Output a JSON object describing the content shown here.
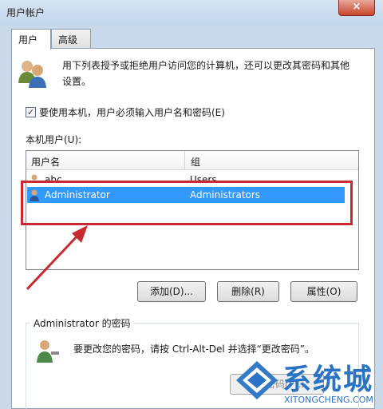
{
  "window": {
    "title": "用户帐户",
    "close_label": "×"
  },
  "tabs": [
    {
      "label": "用户",
      "active": true
    },
    {
      "label": "高级",
      "active": false
    }
  ],
  "description": {
    "line1": "用下列表授予或拒绝用户访问您的计算机，还可以更改其密码和其他",
    "line2": "设置。"
  },
  "require_login": {
    "checked": true,
    "mark": "✓",
    "label": "要使用本机，用户必须输入用户名和密码(E)"
  },
  "users_section": {
    "label": "本机用户(U):",
    "columns": [
      "用户名",
      "组"
    ],
    "rows": [
      {
        "name": "abc",
        "group": "Users",
        "selected": false
      },
      {
        "name": "Administrator",
        "group": "Administrators",
        "selected": true
      }
    ]
  },
  "buttons": {
    "add": "添加(D)...",
    "remove": "删除(R)",
    "properties": "属性(O)"
  },
  "password_group": {
    "title": "Administrator 的密码",
    "text": "要更改您的密码，请按 Ctrl-Alt-Del 并选择“更改密码”。",
    "reset_button": "重置密码(P)..."
  },
  "watermark": {
    "brand": "系统城",
    "site": "XITONGCHENG.COM"
  },
  "colors": {
    "selection": "#3399ff",
    "highlight": "#c9292f",
    "watermark": "#2a73c4"
  }
}
